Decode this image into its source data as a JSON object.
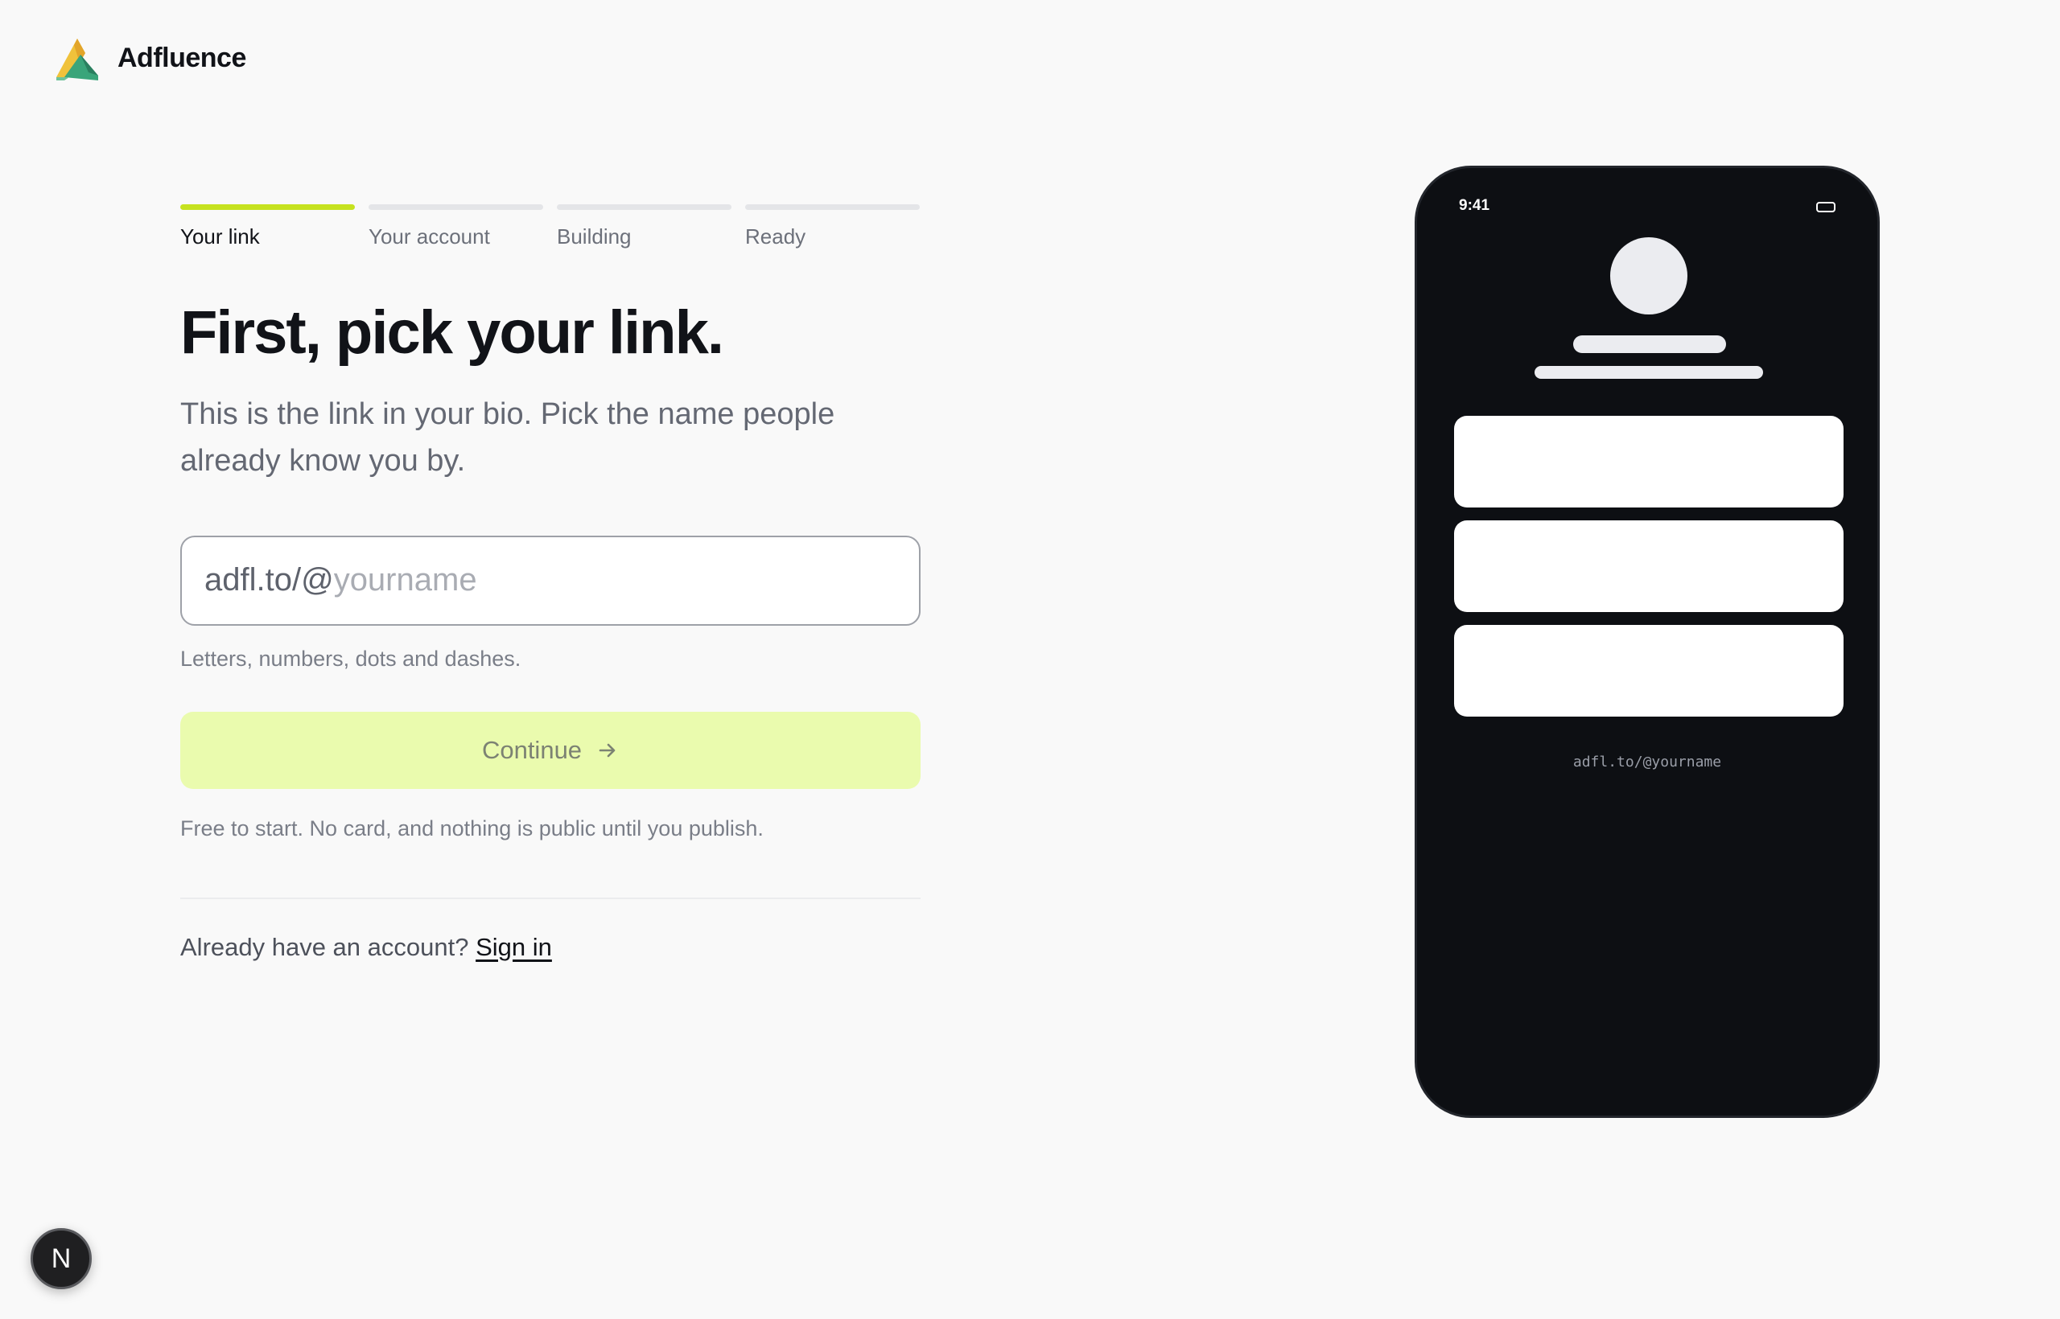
{
  "brand": {
    "name": "Adfluence",
    "logo_icon": "tent-logo-icon"
  },
  "steps": [
    {
      "label": "Your link",
      "active": true
    },
    {
      "label": "Your account",
      "active": false
    },
    {
      "label": "Building",
      "active": false
    },
    {
      "label": "Ready",
      "active": false
    }
  ],
  "main": {
    "headline": "First, pick your link.",
    "subtitle": "This is the link in your bio. Pick the name people already know you by.",
    "link_prefix": "adfl.to/@",
    "link_value": "",
    "link_placeholder": "yourname",
    "hint": "Letters, numbers, dots and dashes.",
    "continue_label": "Continue",
    "continue_icon": "arrow-right-icon",
    "fineprint": "Free to start. No card, and nothing is public until you publish.",
    "signin_prompt": "Already have an account?",
    "signin_link": "Sign in"
  },
  "preview": {
    "time": "9:41",
    "url": "adfl.to/@yourname"
  },
  "badge": {
    "letter": "N"
  },
  "colors": {
    "accent": "#c6e21f",
    "button_bg": "#eafbae",
    "phone_bg": "#0d0f13",
    "page_bg": "#f9f9f9"
  }
}
